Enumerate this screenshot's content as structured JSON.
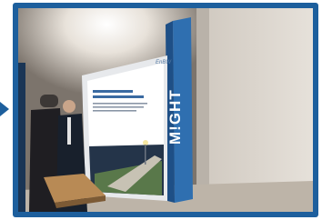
{
  "photo": {
    "description_icon": "photo-icon",
    "colors": {
      "frame": "#1d5f9d",
      "wall": "#d9d3cb",
      "pillar": "#2f6fb0",
      "billboard_panel": "#2b6cb0",
      "floor": "#c9c1b6"
    }
  },
  "pillar_text": "M!GHT",
  "billboard_logo": "EnBW"
}
